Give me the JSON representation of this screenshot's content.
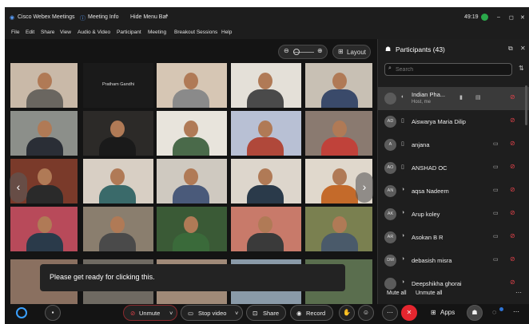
{
  "titlebar": {
    "app_title": "Cisco Webex Meetings",
    "meeting_info": "Meeting Info",
    "hide_menu_bar": "Hide Menu Bar",
    "timer": "49:19"
  },
  "menu": [
    "File",
    "Edit",
    "Share",
    "View",
    "Audio & Video",
    "Participant",
    "Meeting",
    "Breakout Sessions",
    "Help"
  ],
  "toolbar": {
    "layout_label": "Layout"
  },
  "grid": {
    "named_tile": "Pratham Gandhi"
  },
  "toast": "Please get ready for clicking this.",
  "participants": {
    "title": "Participants (43)",
    "search_placeholder": "Search",
    "rows": [
      {
        "initials": "",
        "name": "Indian Pha...",
        "subtitle": "Host, me"
      },
      {
        "initials": "AD",
        "name": "Aiswarya Maria Dilip"
      },
      {
        "initials": "A",
        "name": "anjana"
      },
      {
        "initials": "AO",
        "name": "ANSHAD OC"
      },
      {
        "initials": "AN",
        "name": "aqsa Nadeem"
      },
      {
        "initials": "AK",
        "name": "Arup koley"
      },
      {
        "initials": "AR",
        "name": "Asokan B R"
      },
      {
        "initials": "DM",
        "name": "debasish misra"
      },
      {
        "initials": "",
        "name": "Deepshikha ghorai"
      }
    ],
    "mute_all": "Mute all",
    "unmute_all": "Unmute all"
  },
  "controls": {
    "unmute": "Unmute",
    "stop_video": "Stop video",
    "share": "Share",
    "record": "Record",
    "apps": "Apps"
  },
  "colors": {
    "end_call": "#e5262f",
    "muted": "#e0424a",
    "accent": "#2e74d6"
  }
}
